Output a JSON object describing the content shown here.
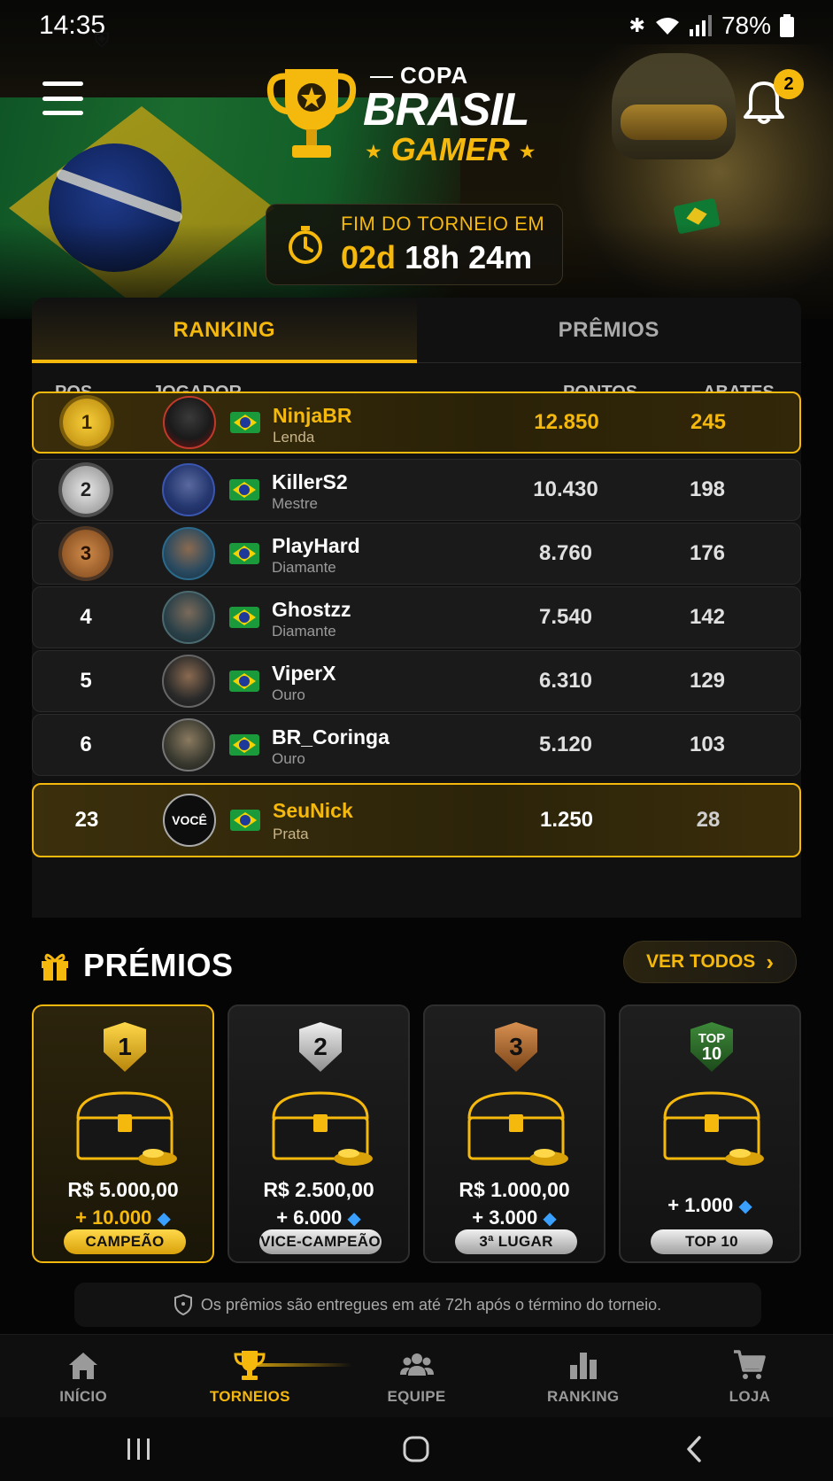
{
  "status_bar": {
    "time": "14:35",
    "battery": "78%"
  },
  "header": {
    "logo": {
      "copa": "COPA",
      "brasil": "BRASIL",
      "gamer": "GAMER"
    },
    "notifications_count": "2",
    "timer": {
      "label": "FIM DO TORNEIO EM",
      "days": "02d",
      "rest": "18h 24m"
    }
  },
  "tabs": [
    {
      "label": "RANKING",
      "active": true
    },
    {
      "label": "PRÊMIOS",
      "active": false
    }
  ],
  "table": {
    "columns": {
      "pos": "POS.",
      "player": "JOGADOR",
      "points": "PONTOS",
      "kills": "ABATES"
    },
    "rows": [
      {
        "pos": "1",
        "name": "NinjaBR",
        "rank": "Lenda",
        "points": "12.850",
        "kills": "245"
      },
      {
        "pos": "2",
        "name": "KillerS2",
        "rank": "Mestre",
        "points": "10.430",
        "kills": "198"
      },
      {
        "pos": "3",
        "name": "PlayHard",
        "rank": "Diamante",
        "points": "8.760",
        "kills": "176"
      },
      {
        "pos": "4",
        "name": "Ghostzz",
        "rank": "Diamante",
        "points": "7.540",
        "kills": "142"
      },
      {
        "pos": "5",
        "name": "ViperX",
        "rank": "Ouro",
        "points": "6.310",
        "kills": "129"
      },
      {
        "pos": "6",
        "name": "BR_Coringa",
        "rank": "Ouro",
        "points": "5.120",
        "kills": "103"
      }
    ],
    "you": {
      "pos": "23",
      "avatar_label": "VOCÊ",
      "name": "SeuNick",
      "rank": "Prata",
      "points": "1.250",
      "kills": "28"
    }
  },
  "prizes": {
    "title": "PRÉMIOS",
    "see_all": "VER TODOS",
    "cards": [
      {
        "badge": "1",
        "money": "R$ 5.000,00",
        "gems": "+ 10.000",
        "label": "CAMPEÃO"
      },
      {
        "badge": "2",
        "money": "R$ 2.500,00",
        "gems": "+ 6.000",
        "label": "VICE-CAMPEÃO"
      },
      {
        "badge": "3",
        "money": "R$ 1.000,00",
        "gems": "+ 3.000",
        "label": "3ª LUGAR"
      },
      {
        "badge_top": "TOP",
        "badge_num": "10",
        "gems": "+ 1.000",
        "label": "TOP 10"
      }
    ],
    "note": "Os prêmios são entregues em até 72h após o término do torneio."
  },
  "bottom_nav": [
    {
      "label": "INÍCIO",
      "icon": "home-icon"
    },
    {
      "label": "TORNEIOS",
      "icon": "trophy-icon",
      "active": true
    },
    {
      "label": "EQUIPE",
      "icon": "team-icon"
    },
    {
      "label": "RANKING",
      "icon": "bar-chart-icon"
    },
    {
      "label": "LOJA",
      "icon": "cart-icon"
    }
  ],
  "colors": {
    "accent": "#f5b80c",
    "background": "#050505",
    "card": "#1a1a1a"
  }
}
